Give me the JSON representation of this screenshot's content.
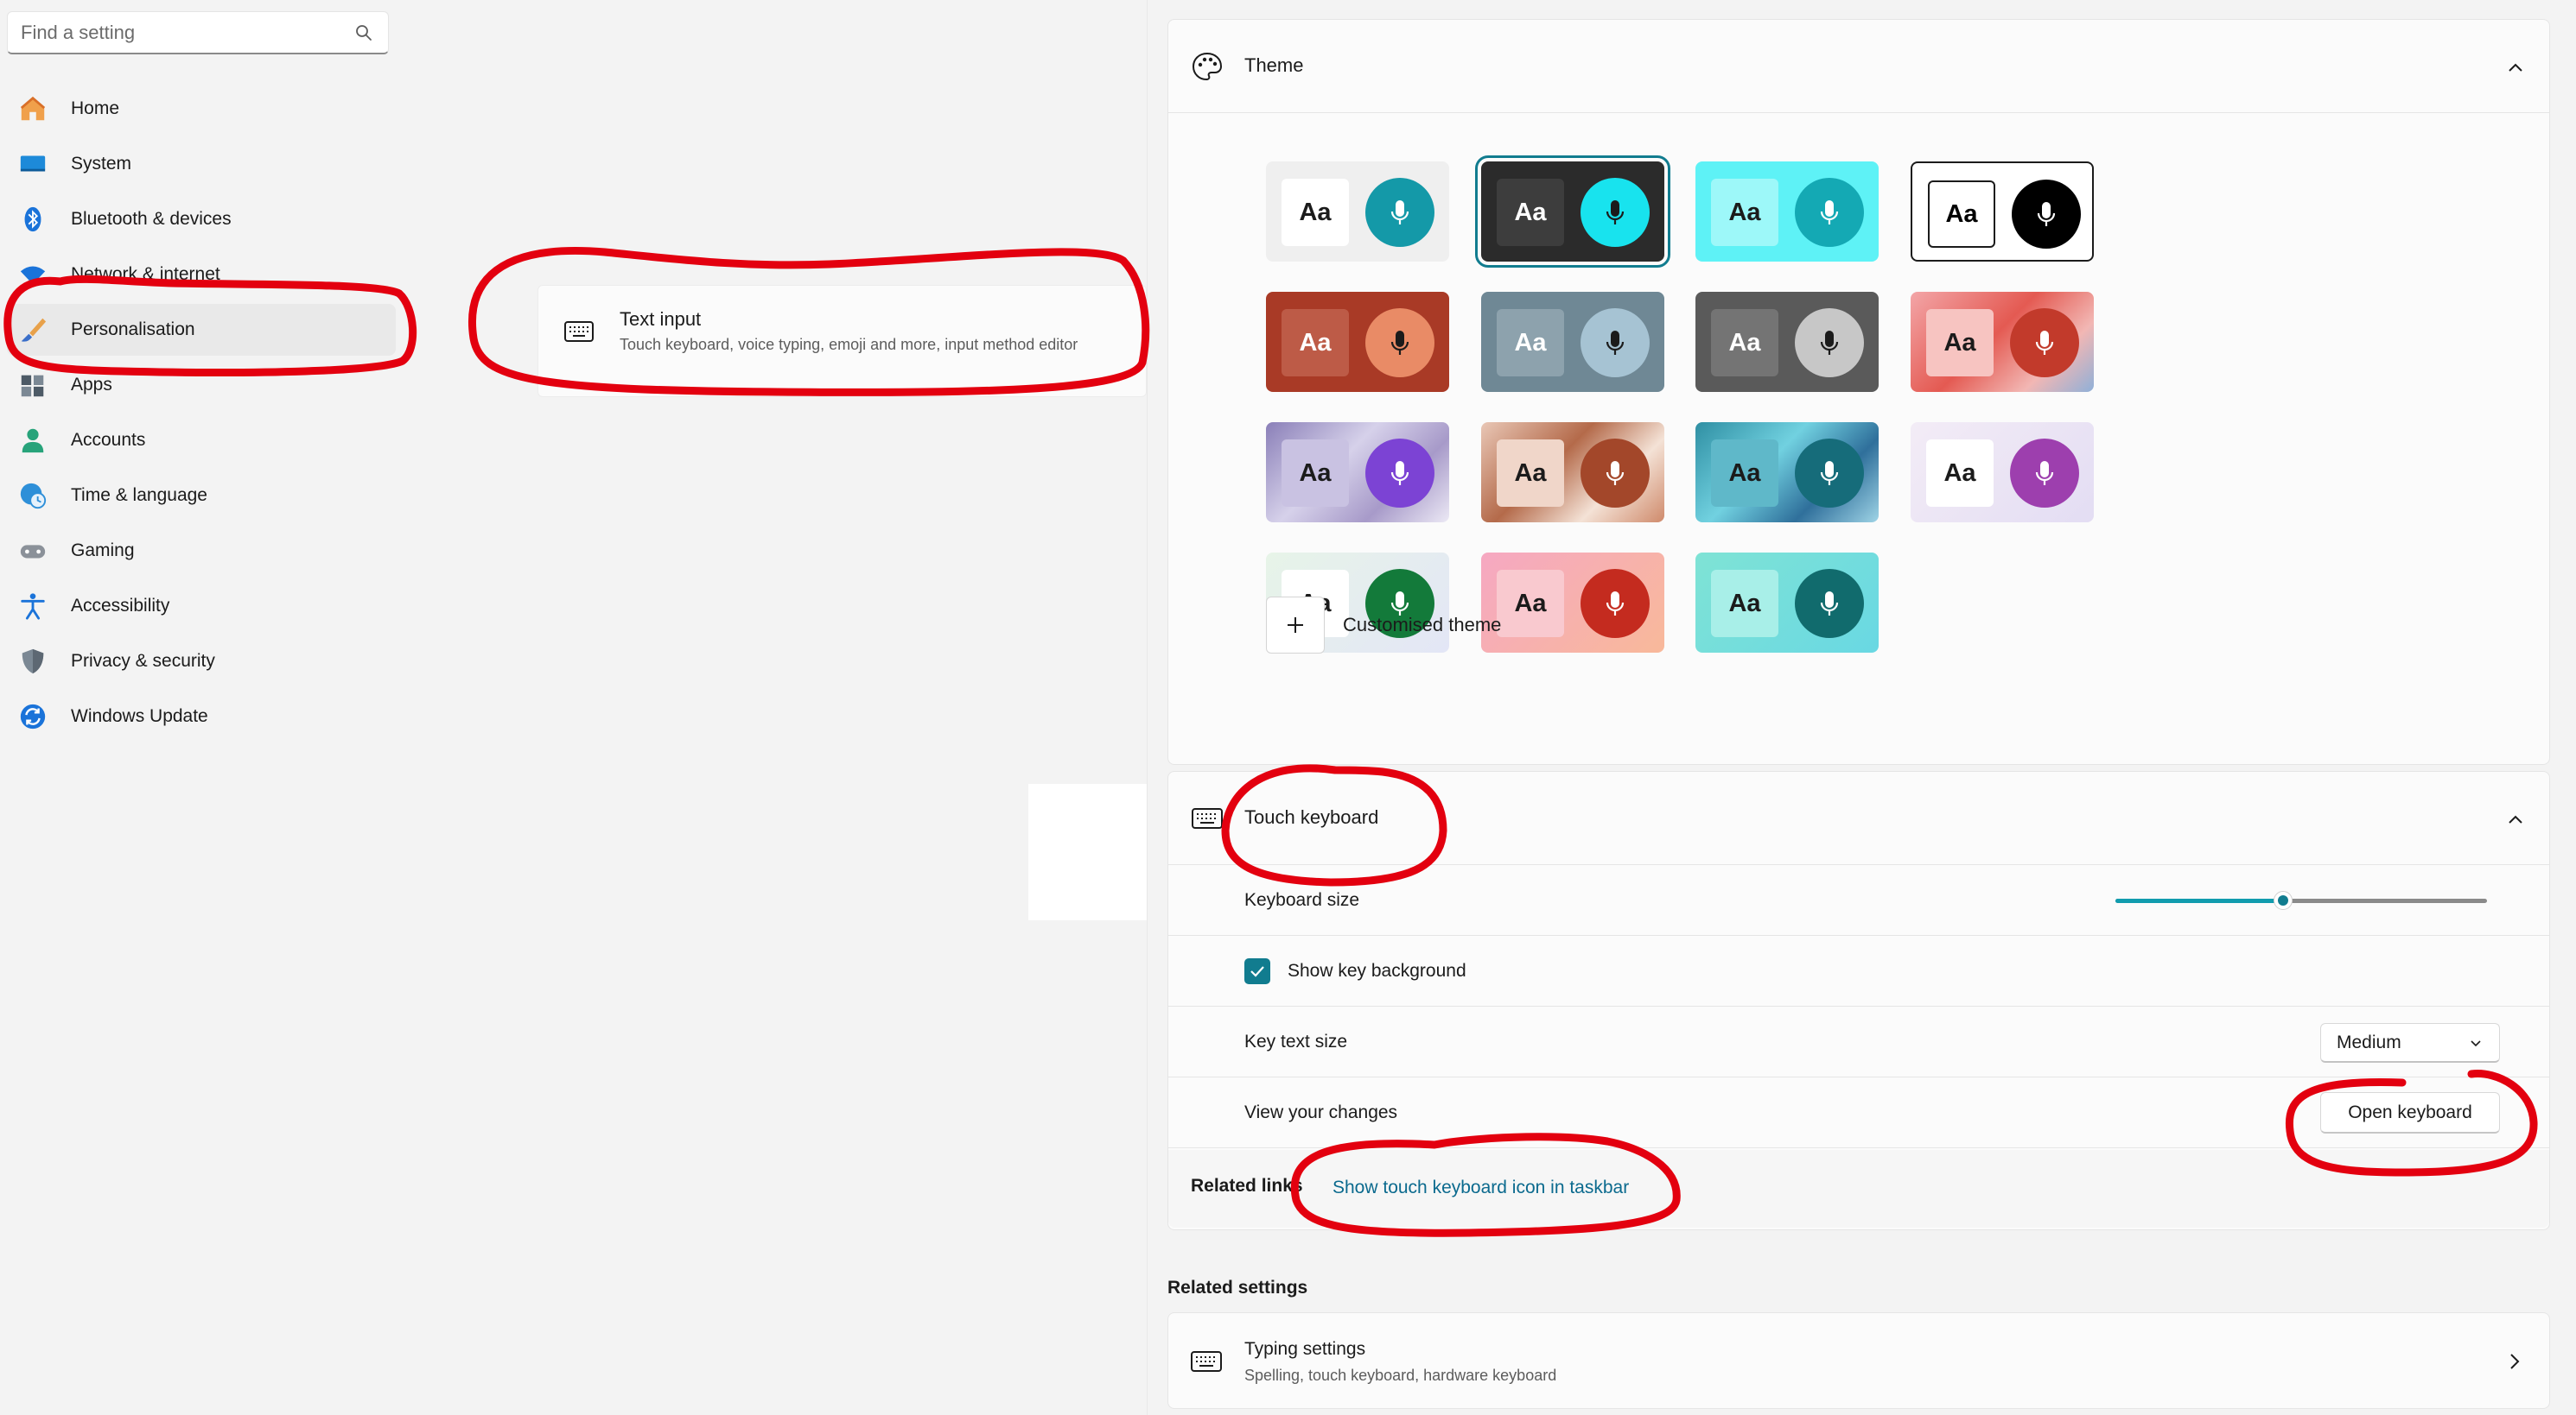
{
  "search": {
    "placeholder": "Find a setting"
  },
  "nav": {
    "items": [
      {
        "label": "Home",
        "icon": "home-icon"
      },
      {
        "label": "System",
        "icon": "system-icon"
      },
      {
        "label": "Bluetooth & devices",
        "icon": "bluetooth-icon"
      },
      {
        "label": "Network & internet",
        "icon": "wifi-icon"
      },
      {
        "label": "Personalisation",
        "icon": "brush-icon",
        "selected": true
      },
      {
        "label": "Apps",
        "icon": "apps-icon"
      },
      {
        "label": "Accounts",
        "icon": "account-icon"
      },
      {
        "label": "Time & language",
        "icon": "globe-clock-icon"
      },
      {
        "label": "Gaming",
        "icon": "gamepad-icon"
      },
      {
        "label": "Accessibility",
        "icon": "accessibility-icon"
      },
      {
        "label": "Privacy & security",
        "icon": "shield-icon"
      },
      {
        "label": "Windows Update",
        "icon": "update-icon"
      }
    ]
  },
  "search_result": {
    "title": "Text input",
    "subtitle": "Touch keyboard, voice typing, emoji and more, input method editor",
    "icon": "keyboard-icon"
  },
  "theme": {
    "title": "Theme",
    "icon": "palette-icon",
    "aa_label": "Aa",
    "tiles": [
      {
        "bg": "#efefef",
        "aa_bg": "#ffffff",
        "aa_fg": "#1b1b1b",
        "mic_bg": "#1499a8",
        "mic_fg": "#ffffff"
      },
      {
        "bg": "#2b2b2b",
        "aa_bg": "#3d3d3d",
        "aa_fg": "#ffffff",
        "mic_bg": "#18e3ee",
        "mic_fg": "#1b1b1b",
        "selected": true
      },
      {
        "bg": "#5ef2f6",
        "aa_bg": "#9df8f9",
        "aa_fg": "#1b1b1b",
        "mic_bg": "#14a9b4",
        "mic_fg": "#ffffff"
      },
      {
        "bg": "#ffffff",
        "aa_bg": "#ffffff",
        "aa_fg": "#000000",
        "mic_bg": "#000000",
        "mic_fg": "#ffffff",
        "border": "#1b1b1b"
      },
      {
        "bg": "#a93a26",
        "aa_bg": "#bd5b47",
        "aa_fg": "#ffffff",
        "mic_bg": "#e98b66",
        "mic_fg": "#1b1b1b"
      },
      {
        "bg": "#6f8895",
        "aa_bg": "#8da2ad",
        "aa_fg": "#ffffff",
        "mic_bg": "#a6c3d3",
        "mic_fg": "#1b1b1b"
      },
      {
        "bg": "#5a5a5a",
        "aa_bg": "#747474",
        "aa_fg": "#ffffff",
        "mic_bg": "#c7c7c7",
        "mic_fg": "#1b1b1b"
      },
      {
        "bg": "linear-gradient(135deg,#f3a6a8,#e45a52 45%,#f2b7b4 75%,#8fb0d8)",
        "aa_bg": "#f7c4c1",
        "aa_fg": "#1b1b1b",
        "mic_bg": "#c23a2b",
        "mic_fg": "#ffffff"
      },
      {
        "bg": "linear-gradient(135deg,#8a7fb8,#d6d1ea 40%,#a79ac9 70%,#ece9f5)",
        "aa_bg": "#c9c2e2",
        "aa_fg": "#1b1b1b",
        "mic_bg": "#7c43d4",
        "mic_fg": "#ffffff"
      },
      {
        "bg": "linear-gradient(135deg,#e9c7b6,#b46a4a 40%,#f4e2d6 70%,#cf8a6b)",
        "aa_bg": "#f0d6c9",
        "aa_fg": "#1b1b1b",
        "mic_bg": "#a3472a",
        "mic_fg": "#ffffff"
      },
      {
        "bg": "linear-gradient(135deg,#2f8fa3,#71d1e0 40%,#2f6f9b 70%,#9fd4e6)",
        "aa_bg": "#5fb8c9",
        "aa_fg": "#1b1b1b",
        "mic_bg": "#166c7a",
        "mic_fg": "#ffffff"
      },
      {
        "bg": "linear-gradient(135deg,#f3ecf6,#e3ddf3)",
        "aa_bg": "#ffffff",
        "aa_fg": "#1b1b1b",
        "mic_bg": "#9d3fae",
        "mic_fg": "#ffffff"
      },
      {
        "bg": "linear-gradient(135deg,#e7f4e8,#e3e6f6)",
        "aa_bg": "#ffffff",
        "aa_fg": "#1b1b1b",
        "mic_bg": "#137a3a",
        "mic_fg": "#ffffff"
      },
      {
        "bg": "linear-gradient(135deg,#f6a8c2,#f8b99a)",
        "aa_bg": "#f9c9cf",
        "aa_fg": "#1b1b1b",
        "mic_bg": "#c42b1f",
        "mic_fg": "#ffffff"
      },
      {
        "bg": "linear-gradient(135deg,#7fe3d5,#69d8e3)",
        "aa_bg": "#a8efe8",
        "aa_fg": "#1b1b1b",
        "mic_bg": "#116b6d",
        "mic_fg": "#ffffff"
      }
    ],
    "custom_label": "Customised theme"
  },
  "touch_keyboard": {
    "title": "Touch keyboard",
    "icon": "keyboard-icon",
    "keyboard_size_label": "Keyboard size",
    "keyboard_size_value": 0.45,
    "show_key_background_label": "Show key background",
    "show_key_background_checked": true,
    "key_text_size_label": "Key text size",
    "key_text_size_value": "Medium",
    "view_changes_label": "View your changes",
    "open_keyboard_label": "Open keyboard",
    "related_links_label": "Related links",
    "related_link_text": "Show touch keyboard icon in taskbar"
  },
  "related_settings": {
    "heading": "Related settings",
    "typing": {
      "title": "Typing settings",
      "subtitle": "Spelling, touch keyboard, hardware keyboard",
      "icon": "keyboard-icon"
    }
  },
  "colors": {
    "accent": "#117c8f",
    "annotation": "#e3000f",
    "link": "#0b6a8e"
  }
}
